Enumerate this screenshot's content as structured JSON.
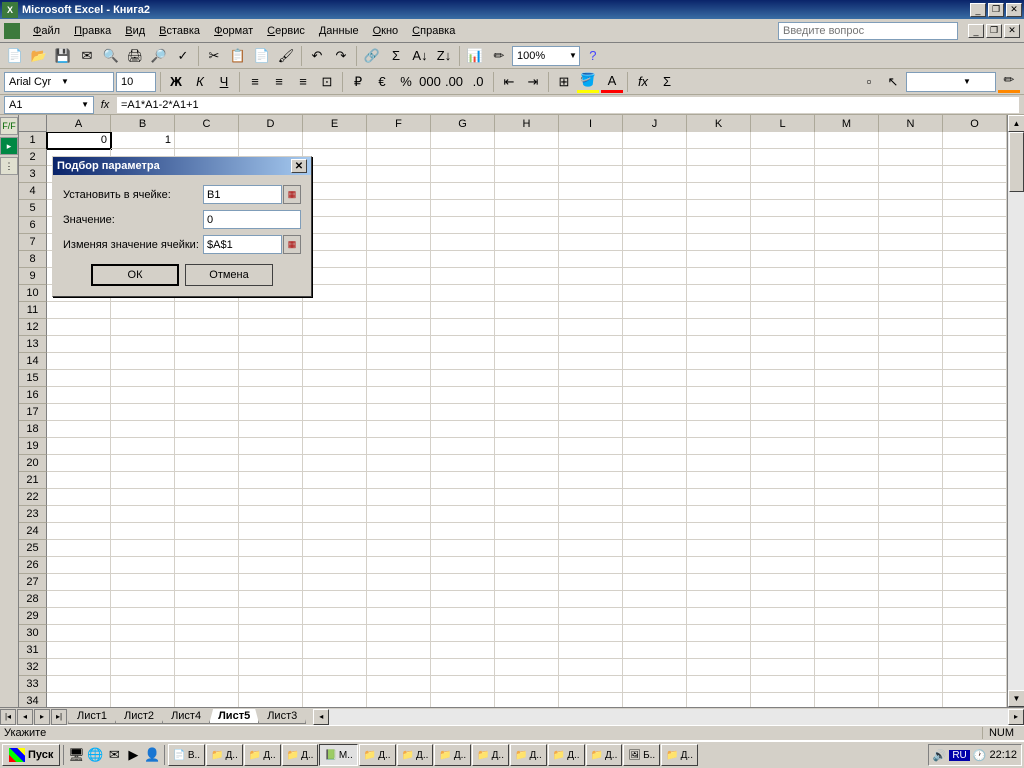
{
  "titlebar": {
    "app_icon": "X",
    "title": "Microsoft Excel - Книга2"
  },
  "menu": {
    "items": [
      "Файл",
      "Правка",
      "Вид",
      "Вставка",
      "Формат",
      "Сервис",
      "Данные",
      "Окно",
      "Справка"
    ],
    "question_placeholder": "Введите вопрос"
  },
  "toolbar2": {
    "font": "Arial Cyr",
    "size": "10",
    "zoom": "100%"
  },
  "formula": {
    "cell_ref": "A1",
    "fx_label": "fx",
    "formula_text": "=A1*A1-2*A1+1"
  },
  "grid": {
    "columns": [
      "A",
      "B",
      "C",
      "D",
      "E",
      "F",
      "G",
      "H",
      "I",
      "J",
      "K",
      "L",
      "M",
      "N",
      "O"
    ],
    "row_count": 34,
    "data": {
      "A1": "0",
      "B1": "1"
    },
    "selected": "A1"
  },
  "sheets": {
    "tabs": [
      "Лист1",
      "Лист2",
      "Лист4",
      "Лист5",
      "Лист3"
    ],
    "active": "Лист5"
  },
  "status": {
    "text": "Укажите",
    "num": "NUM"
  },
  "dialog": {
    "title": "Подбор параметра",
    "label_set_cell": "Установить в ячейке:",
    "val_set_cell": "B1",
    "label_value": "Значение:",
    "val_value": "0",
    "label_changing": "Изменяя значение ячейки:",
    "val_changing": "$A$1",
    "ok": "ОК",
    "cancel": "Отмена"
  },
  "taskbar": {
    "start": "Пуск",
    "tasks": [
      "В..",
      "Д..",
      "Д..",
      "Д..",
      "М..",
      "Д..",
      "Д..",
      "Д..",
      "Д..",
      "Д..",
      "Д..",
      "Д..",
      "Б..",
      "Д.."
    ],
    "lang": "RU",
    "time": "22:12"
  }
}
